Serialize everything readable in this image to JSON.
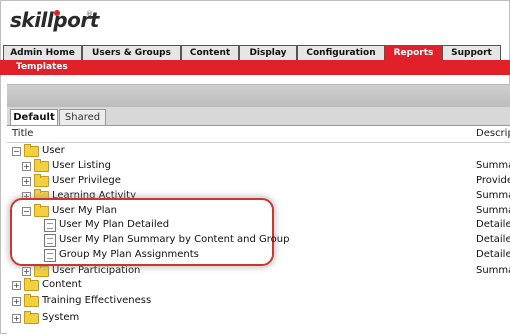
{
  "logo": {
    "text": "skillport",
    "reg": "®"
  },
  "nav": {
    "tabs": [
      "Admin Home",
      "Users & Groups",
      "Content",
      "Display",
      "Configuration",
      "Reports",
      "Support"
    ],
    "active": "Reports"
  },
  "subnav": {
    "item": "Templates"
  },
  "panel_tabs": {
    "default": "Default",
    "shared": "Shared"
  },
  "columns": {
    "title": "Title",
    "description": "Descrip"
  },
  "tree": {
    "user": "User",
    "user_listing": "User Listing",
    "user_privilege": "User Privilege",
    "learning_activity": "Learning Activity",
    "user_my_plan": "User My Plan",
    "my_plan_detailed": "User My Plan Detailed",
    "my_plan_summary": "User My Plan Summary by Content and Group",
    "group_my_plan": "Group My Plan Assignments",
    "user_participation": "User Participation",
    "content": "Content",
    "training_effectiveness": "Training Effectiveness",
    "system": "System"
  },
  "descriptions": {
    "user_listing": "Summa",
    "user_privilege": "Provide",
    "learning_activity": "Summa",
    "user_my_plan": "Summa",
    "my_plan_detailed": "Detailed",
    "my_plan_summary": "Detailed",
    "group_my_plan": "Detailed",
    "user_participation": "Summa"
  },
  "colors": {
    "accent": "#e0212a",
    "highlight": "#c8382f",
    "folder": "#f4d03f"
  }
}
